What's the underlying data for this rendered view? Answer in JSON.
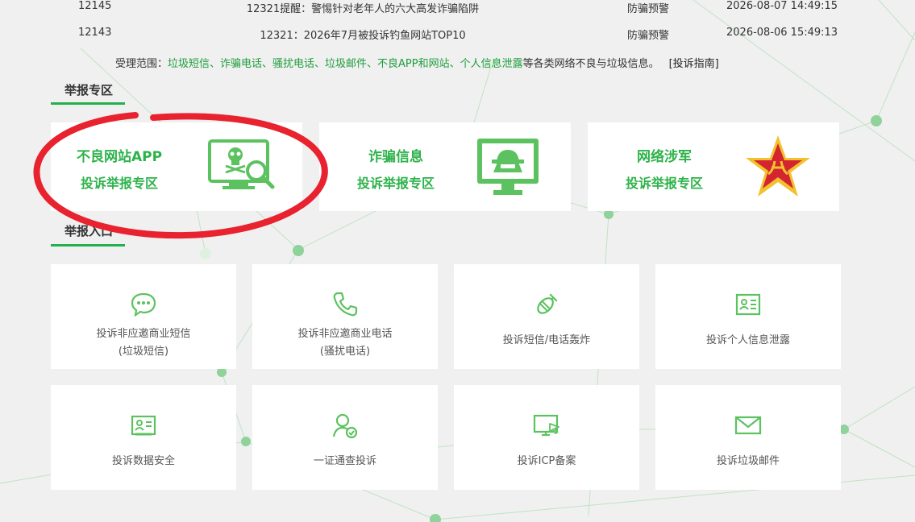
{
  "news": [
    {
      "id": "12145",
      "title": "12321提醒：警惕针对老年人的六大高发诈骗陷阱",
      "category": "防骗预警",
      "date": "2026-08-07 14:49:15"
    },
    {
      "id": "12143",
      "title": "12321：2026年7月被投诉钓鱼网站TOP10",
      "category": "防骗预警",
      "date": "2026-08-06 15:49:13"
    }
  ],
  "scope": {
    "prefix": "受理范围：",
    "items": "垃圾短信、诈骗电话、骚扰电话、垃圾邮件、不良APP和网站、个人信息泄露",
    "suffix": "等各类网络不良与垃圾信息。",
    "guide": "[投诉指南]"
  },
  "sections": {
    "zone_title": "举报专区",
    "entry_title": "举报入口"
  },
  "zones": [
    {
      "title": "不良网站APP",
      "subtitle": "投诉举报专区",
      "icon": "skull-monitor-search-icon"
    },
    {
      "title": "诈骗信息",
      "subtitle": "投诉举报专区",
      "icon": "hacker-monitor-icon"
    },
    {
      "title": "网络涉军",
      "subtitle": "投诉举报专区",
      "icon": "army-star-icon"
    }
  ],
  "entries": [
    {
      "line1": "投诉非应邀商业短信",
      "line2": "(垃圾短信)",
      "icon": "chat-bubble-icon"
    },
    {
      "line1": "投诉非应邀商业电话",
      "line2": "(骚扰电话)",
      "icon": "phone-icon"
    },
    {
      "line1": "投诉短信/电话轰炸",
      "line2": "",
      "icon": "bomb-icon"
    },
    {
      "line1": "投诉个人信息泄露",
      "line2": "",
      "icon": "id-card-icon"
    },
    {
      "line1": "投诉数据安全",
      "line2": "",
      "icon": "data-card-icon"
    },
    {
      "line1": "一证通查投诉",
      "line2": "",
      "icon": "user-check-icon"
    },
    {
      "line1": "投诉ICP备案",
      "line2": "",
      "icon": "monitor-cursor-icon"
    },
    {
      "line1": "投诉垃圾邮件",
      "line2": "",
      "icon": "envelope-icon"
    }
  ],
  "colors": {
    "accent": "#22b14c",
    "zone_text": "#2db24a",
    "icon_green": "#5cc25f",
    "annotation_red": "#e8222e"
  }
}
